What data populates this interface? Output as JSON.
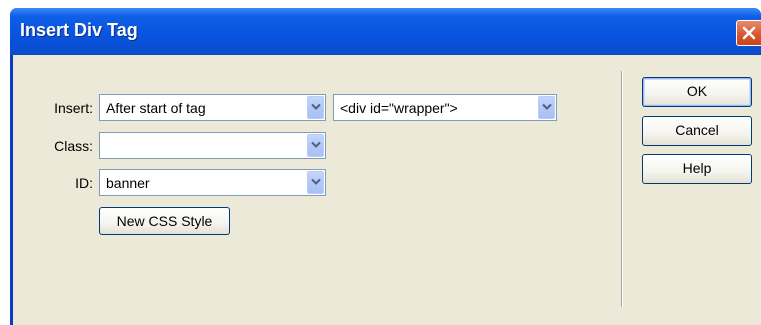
{
  "window": {
    "title": "Insert Div Tag"
  },
  "form": {
    "insert": {
      "label": "Insert:",
      "position_value": "After start of tag",
      "tag_value": "<div id=\"wrapper\">"
    },
    "class": {
      "label": "Class:",
      "value": ""
    },
    "id": {
      "label": "ID:",
      "value": "banner"
    },
    "new_css_label": "New CSS Style"
  },
  "buttons": {
    "ok": "OK",
    "cancel": "Cancel",
    "help": "Help"
  },
  "icons": {
    "close": "close-icon",
    "dropdown": "chevron-down-icon"
  },
  "colors": {
    "titlebar": "#0a54e4",
    "dialog_bg": "#ece9d8",
    "close": "#d9532c",
    "button_border": "#003c74"
  }
}
